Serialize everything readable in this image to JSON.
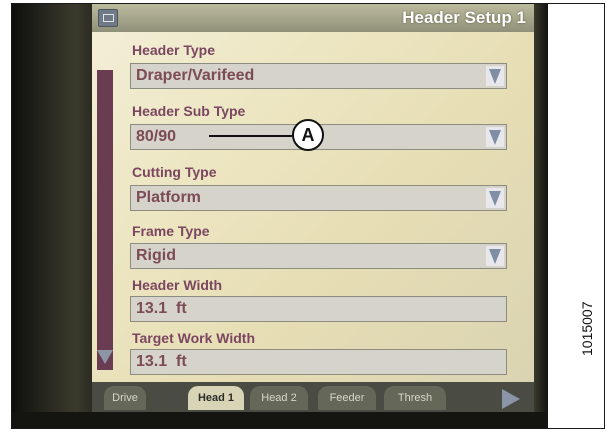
{
  "window": {
    "title": "Header Setup 1",
    "icon": "monitor-icon"
  },
  "fields": [
    {
      "label": "Header Type",
      "value": "Draper/Varifeed",
      "kind": "dropdown"
    },
    {
      "label": "Header Sub Type",
      "value": "80/90",
      "kind": "dropdown"
    },
    {
      "label": "Cutting Type",
      "value": "Platform",
      "kind": "dropdown"
    },
    {
      "label": "Frame Type",
      "value": "Rigid",
      "kind": "dropdown"
    },
    {
      "label": "Header Width",
      "value": "13.1  ft",
      "kind": "text"
    },
    {
      "label": "Target Work Width",
      "value": "13.1  ft",
      "kind": "text"
    }
  ],
  "callout": {
    "letter": "A"
  },
  "tabs": [
    "Drive",
    "Head 1",
    "Head 2",
    "Feeder",
    "Thresh"
  ],
  "active_tab": "Head 1",
  "figure_id": "1015007",
  "colors": {
    "label": "#7b4660",
    "value": "#7d4b55",
    "screen": "#ece5c0",
    "scrollbar": "#6a3c52"
  }
}
